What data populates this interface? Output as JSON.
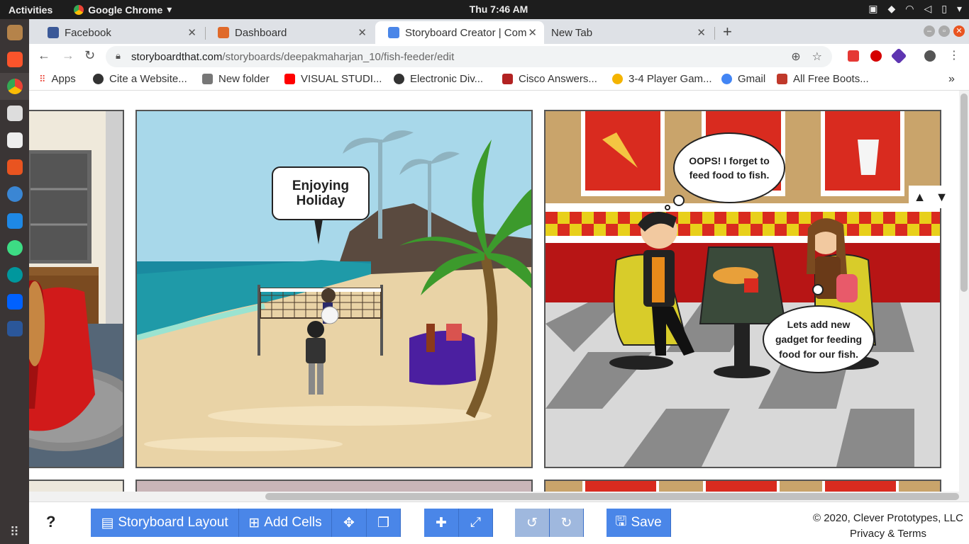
{
  "system": {
    "activities": "Activities",
    "app_name": "Google Chrome",
    "clock": "Thu  7:46 AM"
  },
  "tabs": [
    {
      "label": "Facebook",
      "color": "#3b5998"
    },
    {
      "label": "Dashboard",
      "color": "#e06a2a"
    },
    {
      "label": "Storyboard Creator | Com",
      "color": "#4a86e8"
    },
    {
      "label": "New Tab",
      "color": "#999999"
    }
  ],
  "address": {
    "host": "storyboardthat.com",
    "path": "/storyboards/deepakmaharjan_10/fish-feeder/edit"
  },
  "bookmarks": [
    {
      "label": "Apps",
      "color": "#e94235"
    },
    {
      "label": "Cite a Website...",
      "color": "#333333"
    },
    {
      "label": "New folder",
      "color": "#777777"
    },
    {
      "label": "VISUAL STUDI...",
      "color": "#ff0000"
    },
    {
      "label": "Electronic Div...",
      "color": "#333333"
    },
    {
      "label": "Cisco Answers...",
      "color": "#b22222"
    },
    {
      "label": "3-4 Player Gam...",
      "color": "#f4b400"
    },
    {
      "label": "Gmail",
      "color": "#4285f4"
    },
    {
      "label": "All Free Boots...",
      "color": "#c0392b"
    }
  ],
  "cells": {
    "beach_bubble": "Enjoying\nHoliday",
    "thought_bubble": "OOPS! I forget to\nfeed food to fish.",
    "girl_bubble": "Lets add new\ngadget for feeding\nfood for our fish."
  },
  "toolbar": {
    "help": "?",
    "layout": "Storyboard Layout",
    "add_cells": "Add Cells",
    "save": "Save"
  },
  "footer": {
    "copyright": "© 2020, Clever Prototypes, LLC",
    "privacy": "Privacy & Terms"
  }
}
